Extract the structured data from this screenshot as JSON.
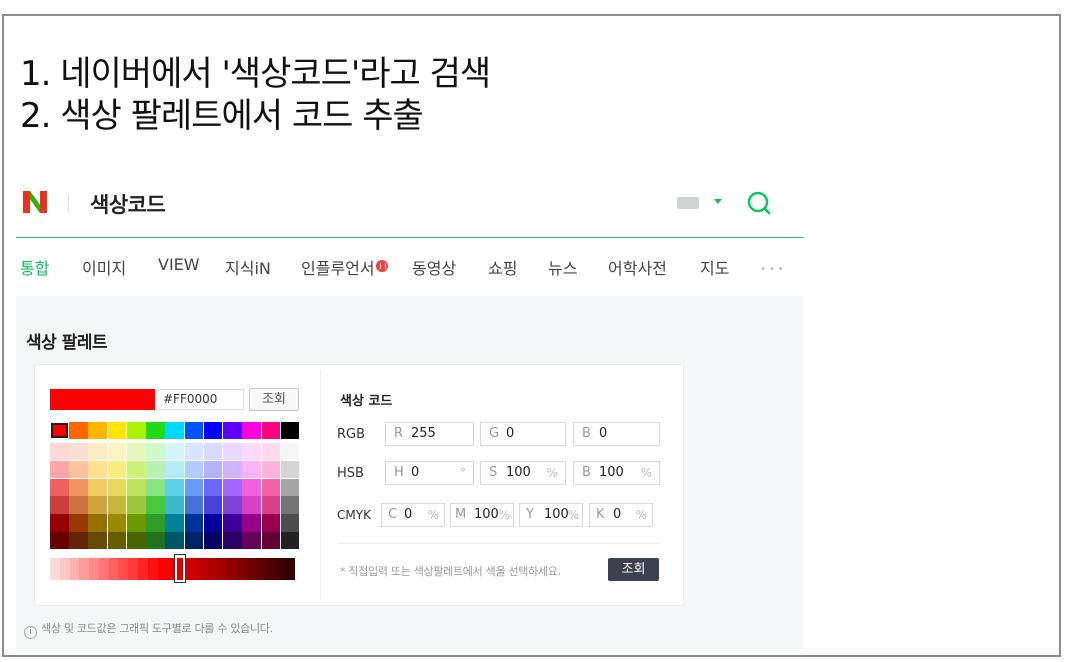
{
  "heading": {
    "line1": "1. 네이버에서 '색상코드'라고 검색",
    "line2": "2. 색상 팔레트에서 코드 추출"
  },
  "search": {
    "query": "색상코드",
    "logo_letter": "N",
    "accent": "#03c75a"
  },
  "tabs": [
    {
      "label": "통합",
      "active": true
    },
    {
      "label": "이미지"
    },
    {
      "label": "VIEW"
    },
    {
      "label": "지식iN"
    },
    {
      "label": "인플루언서"
    },
    {
      "label": "동영상"
    },
    {
      "label": "쇼핑"
    },
    {
      "label": "뉴스"
    },
    {
      "label": "어학사전"
    },
    {
      "label": "지도"
    }
  ],
  "more_label": "•••",
  "palette": {
    "title": "색상 팔레트",
    "hex_value": "#FF0000",
    "preview_color": "#FF0000",
    "lookup_label": "조회",
    "code_title": "색상 코드",
    "rgb": {
      "label": "RGB",
      "r_key": "R",
      "r": "255",
      "g_key": "G",
      "g": "0",
      "b_key": "B",
      "b": "0"
    },
    "hsb": {
      "label": "HSB",
      "h_key": "H",
      "h": "0",
      "h_unit": "°",
      "s_key": "S",
      "s": "100",
      "s_unit": "%",
      "b_key": "B",
      "b": "100",
      "b_unit": "%"
    },
    "cmyk": {
      "label": "CMYK",
      "c_key": "C",
      "c": "0",
      "c_unit": "%",
      "m_key": "M",
      "m": "100",
      "m_unit": "%",
      "y_key": "Y",
      "y": "100",
      "y_unit": "%",
      "k_key": "K",
      "k": "0",
      "k_unit": "%"
    },
    "note": "* 직접입력 또는 색상팔레트에서 색을 선택하세요.",
    "lookup_dark_label": "조회",
    "footnote": "색상 및 코드값은 그래픽 도구별로 다를 수 있습니다.",
    "rows": [
      [
        "#FF0000",
        "#FF6600",
        "#FFB400",
        "#FFE400",
        "#ABF200",
        "#1DDB16",
        "#00D8FF",
        "#0054FF",
        "#0100FF",
        "#5F00FF",
        "#FF00DD",
        "#FF007F",
        "#000000"
      ],
      [
        "#FFD8D8",
        "#FAE0D4",
        "#FAECC5",
        "#FAF4C0",
        "#E4F7BA",
        "#CEFBC9",
        "#D4F4FA",
        "#D9E5FF",
        "#DAD9FF",
        "#E8D9FF",
        "#FFD9FA",
        "#FFD9EC",
        "#F6F6F6"
      ],
      [
        "#FFA7A7",
        "#FFC19E",
        "#FFE08C",
        "#FAED7D",
        "#CEF279",
        "#B7F0B1",
        "#B2EBF4",
        "#B2CCFF",
        "#B5B2FF",
        "#D1B2FF",
        "#FFB2F5",
        "#FFB2D9",
        "#D5D5D5"
      ],
      [
        "#F15F5F",
        "#F29661",
        "#F2CB61",
        "#E5D85C",
        "#BCE55C",
        "#86E57F",
        "#5CD1E5",
        "#6799FF",
        "#6B66FF",
        "#A566FF",
        "#F361DC",
        "#F361A6",
        "#A6A6A6"
      ],
      [
        "#CC3D3D",
        "#CC723D",
        "#CCA63D",
        "#C4B73B",
        "#9FC93C",
        "#47C83E",
        "#3DB7CC",
        "#4374D9",
        "#4641D9",
        "#8041D9",
        "#D941C5",
        "#D9418C",
        "#747474"
      ],
      [
        "#980000",
        "#993800",
        "#997000",
        "#998A00",
        "#6B9900",
        "#2F9D27",
        "#008299",
        "#003399",
        "#050099",
        "#3F0099",
        "#990085",
        "#99004C",
        "#4C4C4C"
      ],
      [
        "#670000",
        "#662500",
        "#664B00",
        "#665C00",
        "#476600",
        "#22741C",
        "#005766",
        "#002266",
        "#030066",
        "#2A0066",
        "#660058",
        "#660033",
        "#212121"
      ]
    ],
    "slider_colors": [
      "#FFD8D8",
      "#FFC4C4",
      "#FFB0B0",
      "#FF9C9C",
      "#FF8888",
      "#FF7474",
      "#FF6060",
      "#FF4C4C",
      "#FF3838",
      "#FF2424",
      "#FF1010",
      "#FF0000",
      "#F00000",
      "#E00000",
      "#D00000",
      "#C00000",
      "#B00000",
      "#A00000",
      "#900000",
      "#800000",
      "#700000",
      "#600000",
      "#500000",
      "#400000",
      "#300000"
    ]
  }
}
